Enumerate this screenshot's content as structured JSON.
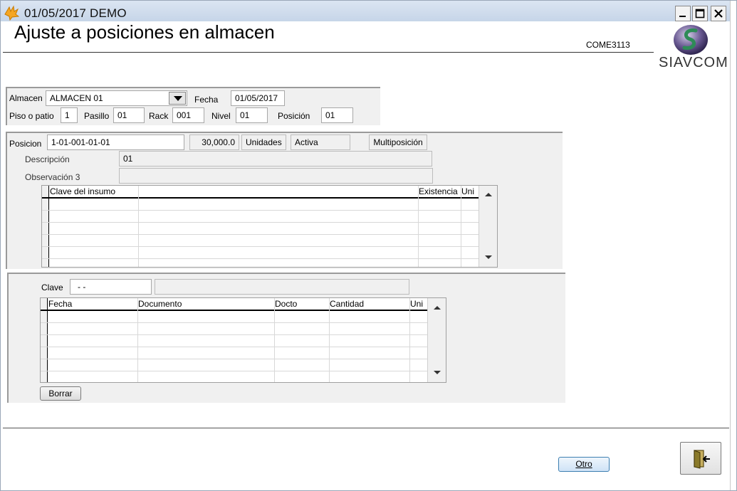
{
  "window": {
    "title": "01/05/2017  DEMO",
    "heading": "Ajuste a  posiciones en almacen",
    "form_code": "COME3113",
    "logo_text": "SIAVCOM"
  },
  "location": {
    "almacen_label": "Almacen",
    "almacen_value": "ALMACEN 01",
    "fecha_label": "Fecha",
    "fecha_value": "01/05/2017",
    "piso_label": "Piso o patio",
    "piso_value": "1",
    "pasillo_label": "Pasillo",
    "pasillo_value": "01",
    "rack_label": "Rack",
    "rack_value": "001",
    "nivel_label": "Nivel",
    "nivel_value": "01",
    "posicion_label": "Posición",
    "posicion_value": "01"
  },
  "position": {
    "posicion_label": "Posicion",
    "posicion_value": "1-01-001-01-01",
    "cantidad": "30,000.0",
    "unidades": "Unidades",
    "estado": "Activa",
    "multiposicion": "Multiposición",
    "descripcion_label": "Descripción",
    "descripcion_value": "01",
    "observacion_label": "Observación 3",
    "observacion_value": ""
  },
  "insumos_grid": {
    "columns": [
      "Clave del insumo",
      "",
      "Existencia",
      "Uni"
    ],
    "rows": []
  },
  "movimientos": {
    "clave_label": "Clave",
    "clave_value": "- -",
    "clave_desc": "",
    "columns": [
      "Fecha",
      "Documento",
      "Docto",
      "Cantidad",
      "Uni"
    ],
    "rows": []
  },
  "buttons": {
    "borrar": "Borrar",
    "otro": "Otro"
  },
  "icons": [
    "app-icon",
    "minimize-icon",
    "maximize-icon",
    "close-icon",
    "dropdown-arrow-icon",
    "scroll-up-icon",
    "scroll-down-icon",
    "exit-door-icon"
  ]
}
